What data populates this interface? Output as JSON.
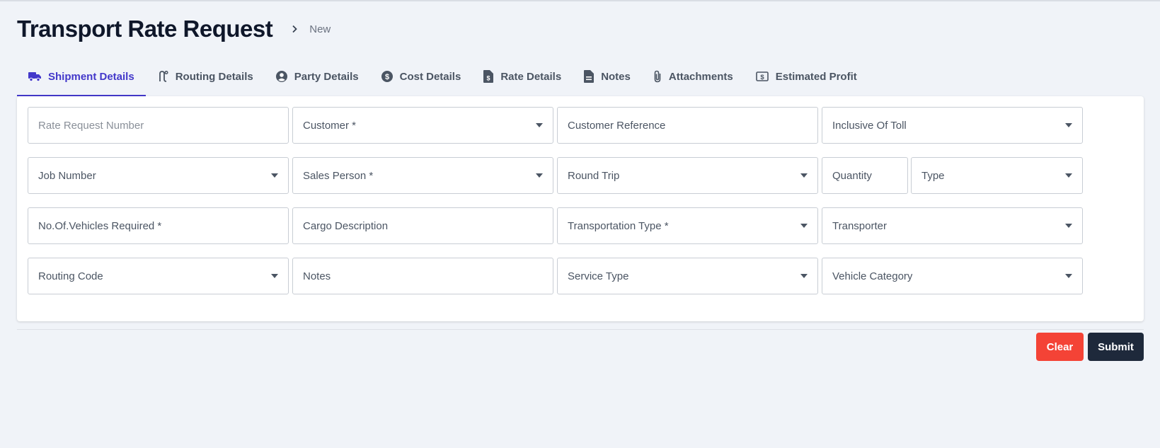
{
  "page": {
    "title": "Transport Rate Request",
    "breadcrumb": "New"
  },
  "tabs": [
    {
      "label": "Shipment Details",
      "icon": "truck-icon",
      "active": true
    },
    {
      "label": "Routing Details",
      "icon": "route-icon"
    },
    {
      "label": "Party Details",
      "icon": "user-circle-icon"
    },
    {
      "label": "Cost Details",
      "icon": "dollar-circle-icon"
    },
    {
      "label": "Rate Details",
      "icon": "invoice-icon"
    },
    {
      "label": "Notes",
      "icon": "document-icon"
    },
    {
      "label": "Attachments",
      "icon": "paperclip-icon"
    },
    {
      "label": "Estimated Profit",
      "icon": "money-bill-icon"
    }
  ],
  "form": {
    "rate_request_number": {
      "placeholder": "Rate Request Number"
    },
    "customer": {
      "label": "Customer *"
    },
    "customer_reference": {
      "label": "Customer Reference"
    },
    "inclusive_of_toll": {
      "label": "Inclusive Of Toll"
    },
    "job_number": {
      "label": "Job Number"
    },
    "sales_person": {
      "label": "Sales Person *"
    },
    "round_trip": {
      "label": "Round Trip"
    },
    "quantity": {
      "label": "Quantity"
    },
    "type": {
      "label": "Type"
    },
    "vehicles_required": {
      "label": "No.Of.Vehicles Required *"
    },
    "cargo_description": {
      "label": "Cargo Description"
    },
    "transportation_type": {
      "label": "Transportation Type *"
    },
    "transporter": {
      "label": "Transporter"
    },
    "routing_code": {
      "label": "Routing Code"
    },
    "notes": {
      "label": "Notes"
    },
    "service_type": {
      "label": "Service Type"
    },
    "vehicle_category": {
      "label": "Vehicle Category"
    }
  },
  "actions": {
    "clear_label": "Clear",
    "submit_label": "Submit"
  },
  "colors": {
    "accent": "#4338ca",
    "clear": "#f44336",
    "submit": "#1e293b",
    "background": "#f0f3f8"
  }
}
